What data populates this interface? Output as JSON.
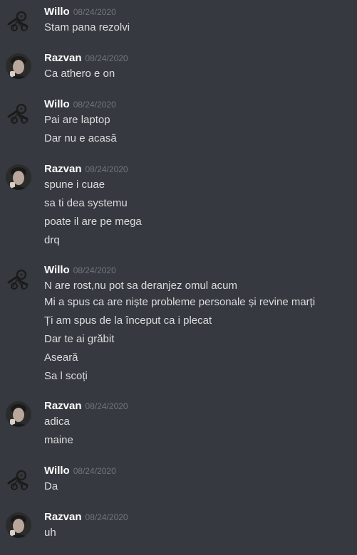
{
  "colors": {
    "background": "#36393f",
    "author": "#ffffff",
    "timestamp": "#72767d",
    "text": "#dcddde"
  },
  "messages": [
    {
      "author": "Willo",
      "avatar": "willo-avatar-icon",
      "timestamp": "08/24/2020",
      "lines": [
        "Stam pana rezolvi"
      ]
    },
    {
      "author": "Razvan",
      "avatar": "razvan-avatar-icon",
      "timestamp": "08/24/2020",
      "lines": [
        "Ca athero e on"
      ]
    },
    {
      "author": "Willo",
      "avatar": "willo-avatar-icon",
      "timestamp": "08/24/2020",
      "lines": [
        "Pai are laptop",
        "Dar nu e acasă"
      ]
    },
    {
      "author": "Razvan",
      "avatar": "razvan-avatar-icon",
      "timestamp": "08/24/2020",
      "lines": [
        "spune i cuae",
        "sa ti dea systemu",
        "poate il are pe mega",
        "drq"
      ]
    },
    {
      "author": "Willo",
      "avatar": "willo-avatar-icon",
      "timestamp": "08/24/2020",
      "lines": [
        "N are rost,nu pot sa deranjez omul acum",
        "Mi a spus ca are niște probleme personale și revine marți",
        "Ți am spus de la început ca i plecat",
        "Dar te ai grăbit",
        "Aseară",
        "Sa l scoți"
      ]
    },
    {
      "author": "Razvan",
      "avatar": "razvan-avatar-icon",
      "timestamp": "08/24/2020",
      "lines": [
        "adica",
        "maine"
      ]
    },
    {
      "author": "Willo",
      "avatar": "willo-avatar-icon",
      "timestamp": "08/24/2020",
      "lines": [
        "Da"
      ]
    },
    {
      "author": "Razvan",
      "avatar": "razvan-avatar-icon",
      "timestamp": "08/24/2020",
      "lines": [
        "uh"
      ]
    }
  ]
}
